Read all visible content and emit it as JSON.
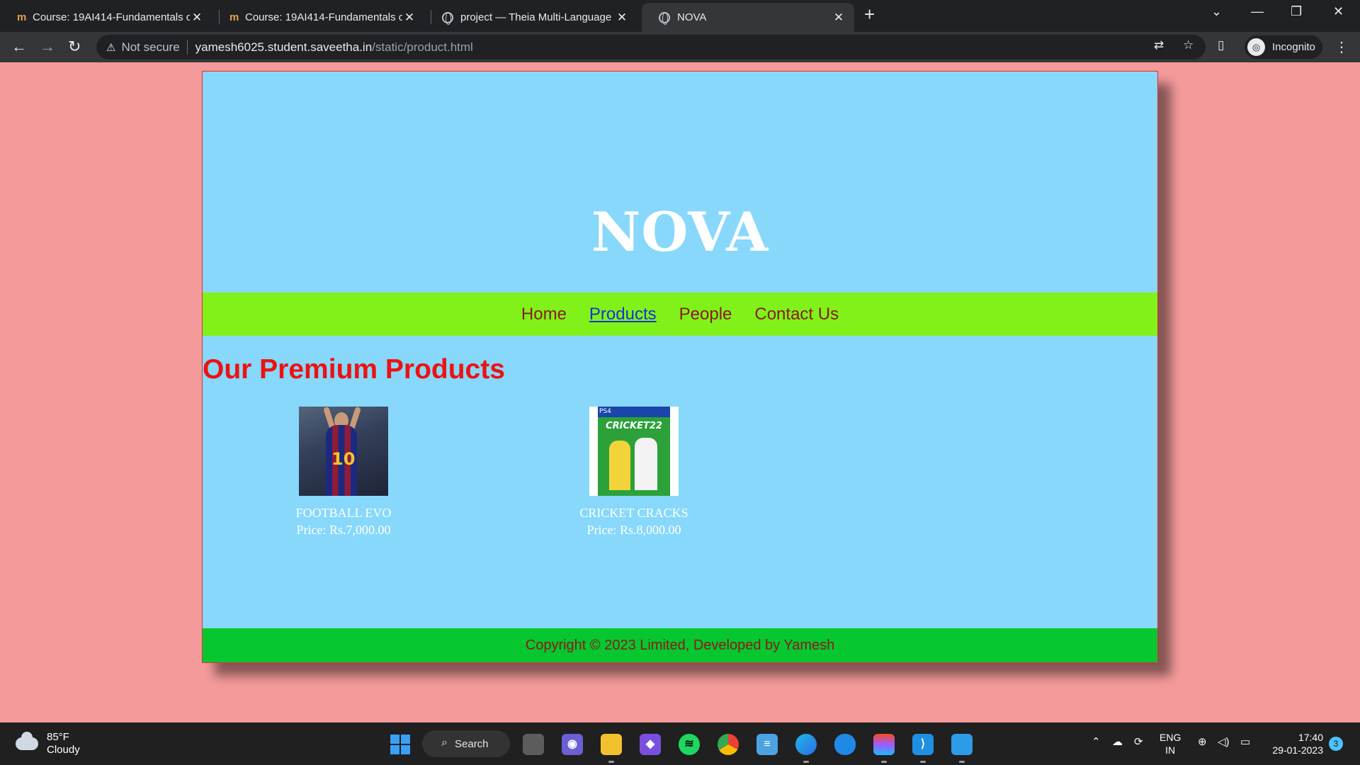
{
  "browser": {
    "tabs": [
      {
        "favicon": "moodle-icon",
        "favicon_text": "m",
        "title": "Course: 19AI414-Fundamentals o",
        "close": "✕"
      },
      {
        "favicon": "moodle-icon",
        "favicon_text": "m",
        "title": "Course: 19AI414-Fundamentals o",
        "close": "✕"
      },
      {
        "favicon": "globe-icon",
        "title": "project — Theia Multi-Language",
        "close": "✕"
      },
      {
        "favicon": "globe-icon",
        "title": "NOVA",
        "close": "✕",
        "active": true
      }
    ],
    "new_tab": "+",
    "window_controls": {
      "tab_search": "⌄",
      "minimize": "—",
      "restore": "❐",
      "close": "✕"
    },
    "address_bar": {
      "security_icon": "⚠",
      "security_text": "Not secure",
      "url_host": "yamesh6025.student.saveetha.in",
      "url_path": "/static/product.html"
    },
    "profile": {
      "label": "Incognito",
      "icon": "incognito-icon"
    },
    "nav": {
      "back": "←",
      "forward": "→",
      "reload": "↻"
    }
  },
  "page": {
    "brand": "NOVA",
    "nav_links": [
      {
        "label": "Home",
        "current": false
      },
      {
        "label": "Products",
        "current": true
      },
      {
        "label": "People",
        "current": false
      },
      {
        "label": "Contact Us",
        "current": false
      }
    ],
    "section_title": "Our Premium Products",
    "products": [
      {
        "name": "FOOTBALL EVO",
        "price": "Price: Rs.7,000.00",
        "thumb_number": "10"
      },
      {
        "name": "CRICKET CRACKS",
        "price": "Price: Rs.8,000.00",
        "thumb_title": "CRICKET22",
        "thumb_platform": "PS4"
      }
    ],
    "footer": "Copyright © 2023 Limited, Developed by Yamesh",
    "colors": {
      "background": "#f49a9a",
      "header": "#87d8fb",
      "navbar": "#80f21a",
      "footer": "#06c72f",
      "title": "#ee1111",
      "nav_link": "#8b1a1a",
      "nav_current": "#1a33d0"
    }
  },
  "taskbar": {
    "weather": {
      "temp": "85°F",
      "condition": "Cloudy"
    },
    "search_label": "Search",
    "apps": [
      "task-view-icon",
      "teams-icon",
      "file-explorer-icon",
      "copilot-icon",
      "spotify-icon",
      "chrome-icon",
      "notepad-icon",
      "edge-icon",
      "onedrive-icon",
      "figma-icon",
      "vscode-icon",
      "photos-icon"
    ],
    "tray": {
      "lang_top": "ENG",
      "lang_bottom": "IN",
      "time": "17:40",
      "date": "29-01-2023",
      "notification_count": "3"
    }
  }
}
